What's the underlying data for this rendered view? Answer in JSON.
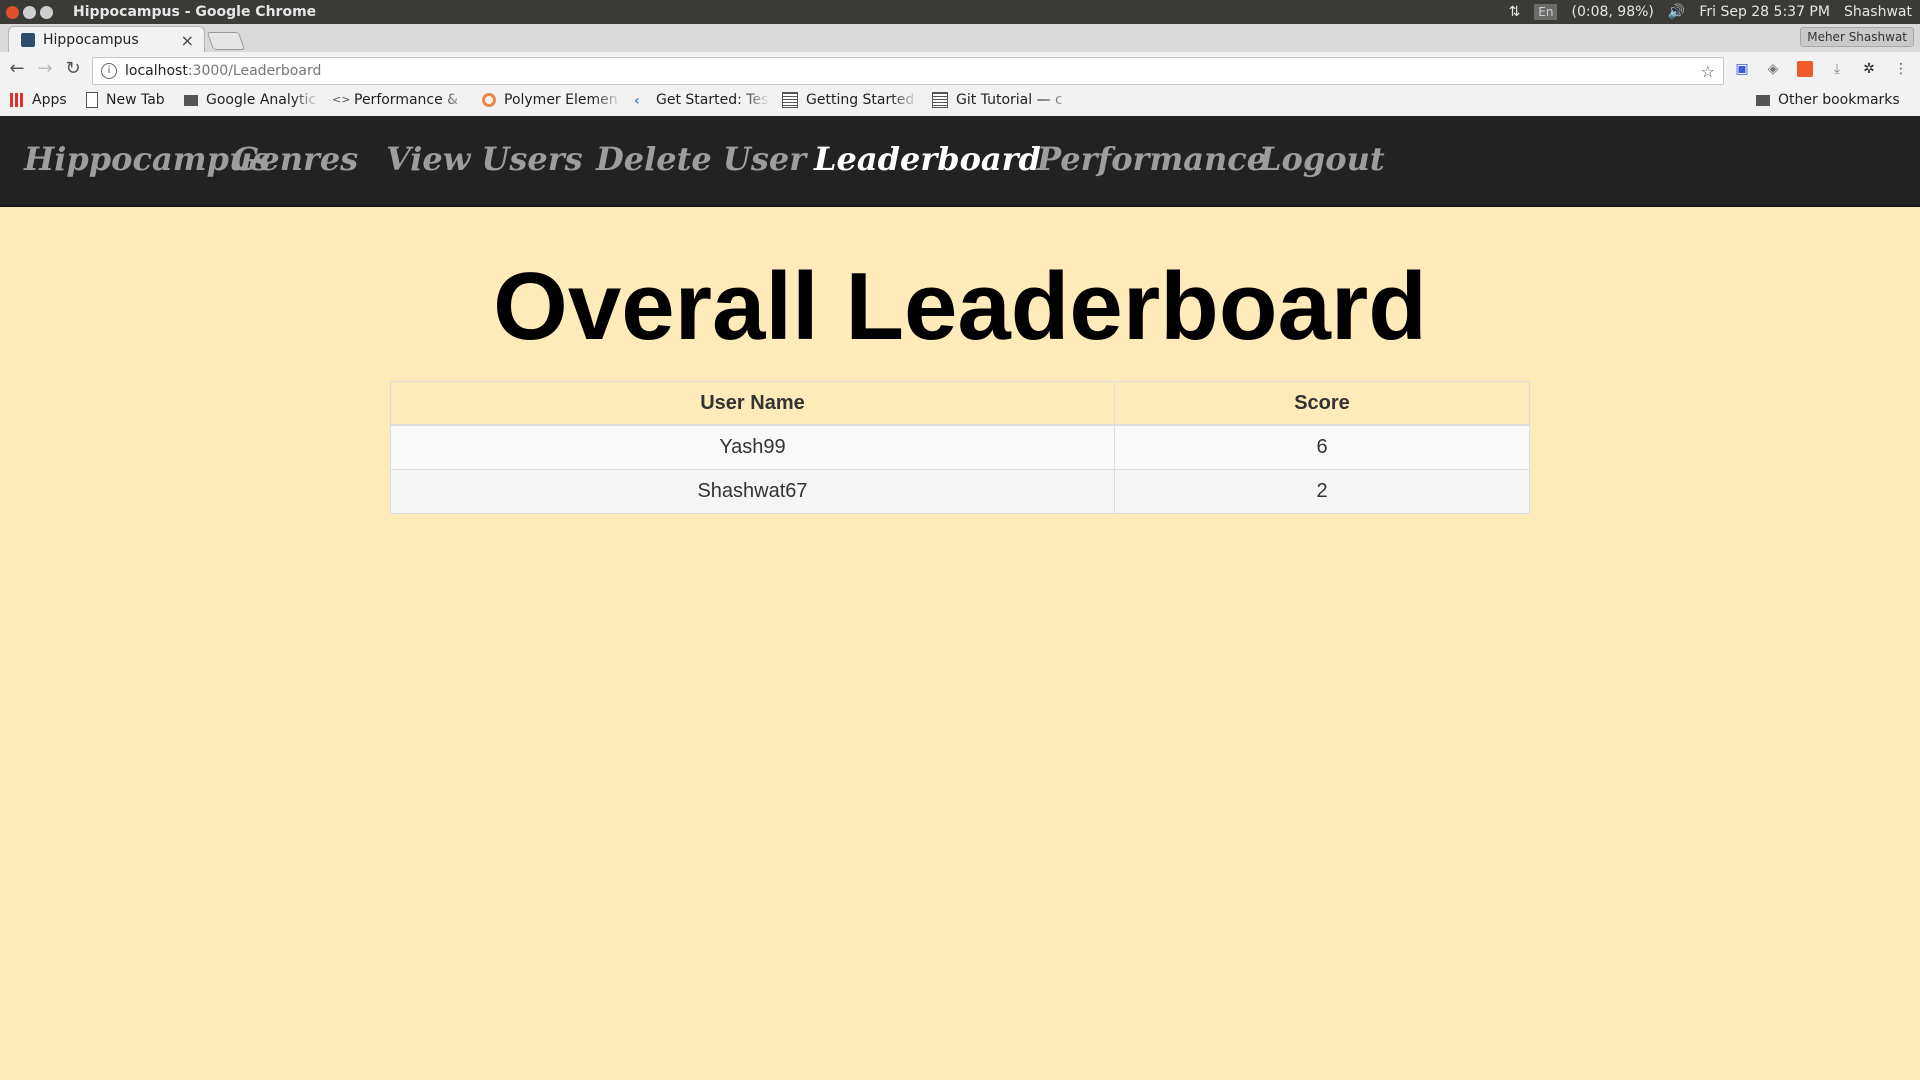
{
  "os": {
    "window_title": "Hippocampus - Google Chrome",
    "lang": "En",
    "battery": "(0:08, 98%)",
    "datetime": "Fri Sep 28  5:37 PM",
    "user": "Shashwat"
  },
  "browser": {
    "tab_title": "Hippocampus",
    "profile": "Meher Shashwat",
    "url_host": "localhost",
    "url_path": ":3000/Leaderboard",
    "bookmarks": [
      {
        "label": "Apps",
        "icon": "apps-grid-icon"
      },
      {
        "label": "New Tab",
        "icon": "page-icon"
      },
      {
        "label": "Google Analytic",
        "icon": "folder-icon"
      },
      {
        "label": "Performance & ",
        "icon": "code-icon"
      },
      {
        "label": "Polymer Elemen",
        "icon": "polymer-icon"
      },
      {
        "label": "Get Started: Tes",
        "icon": "flutter-icon"
      },
      {
        "label": "Getting Started",
        "icon": "doc-icon"
      },
      {
        "label": "Git Tutorial — c",
        "icon": "doc-icon"
      }
    ],
    "other_bookmarks": "Other bookmarks"
  },
  "navbar": {
    "brand": "Hippocampus",
    "items": [
      "Genres",
      "View Users",
      "Delete User",
      "Leaderboard",
      "Performance",
      "Logout"
    ],
    "active": "Leaderboard"
  },
  "main": {
    "title": "Overall Leaderboard",
    "table": {
      "headers": [
        "User Name",
        "Score"
      ],
      "rows": [
        [
          "Yash99",
          "6"
        ],
        [
          "Shashwat67",
          "2"
        ]
      ]
    }
  },
  "colors": {
    "page_background": "#ffeab9",
    "navbar_background": "#222222",
    "nav_inactive": "#9d9d9d",
    "nav_active": "#ffffff"
  }
}
